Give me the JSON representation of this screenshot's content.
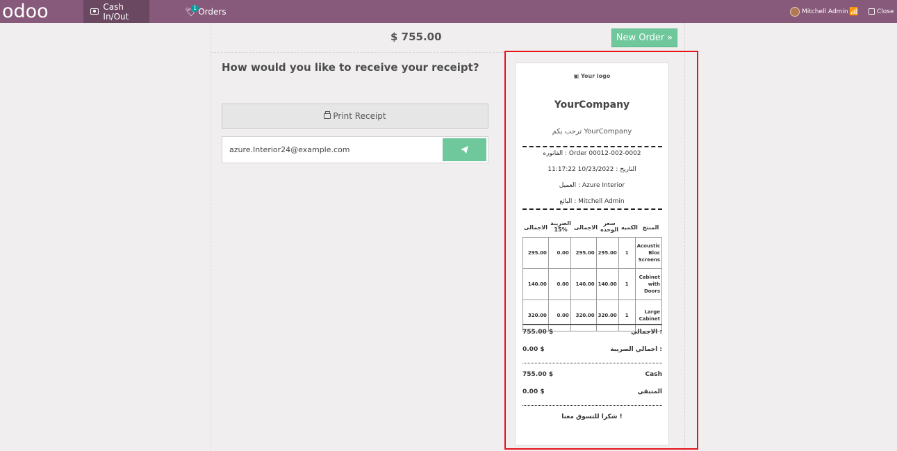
{
  "navbar": {
    "logo_text": "odoo",
    "cash_label": "Cash In/Out",
    "orders_label": "Orders",
    "orders_badge": "1",
    "user_name": "Mitchell Admin",
    "close_label": "Close"
  },
  "main": {
    "amount": "$ 755.00",
    "new_order_label": "New Order »",
    "question": "How would you like to receive your receipt?",
    "print_label": "Print Receipt",
    "email_value": "azure.Interior24@example.com"
  },
  "receipt": {
    "logo": "Your logo",
    "company": "YourCompany",
    "welcome": "ترحب بكم YourCompany",
    "order_line": "الفاتوره : Order 00012-002-0002",
    "date_line": "التاريخ : 10/23/2022 11:17:22",
    "customer_line": "العميل : Azure Interior",
    "seller_line": "البائع : Mitchell Admin",
    "headers": {
      "product": "المنتج",
      "qty": "الكميه",
      "unit_price": "سعر الوحده",
      "total": "الاجمالى",
      "tax": "الضريبة 15%",
      "grand": "الاجمالى"
    },
    "lines": [
      {
        "product": "Acoustic Bloc Screens",
        "qty": "1",
        "unit_price": "295.00",
        "total": "295.00",
        "tax": "0.00",
        "grand": "295.00"
      },
      {
        "product": "Cabinet with Doors",
        "qty": "1",
        "unit_price": "140.00",
        "total": "140.00",
        "tax": "0.00",
        "grand": "140.00"
      },
      {
        "product": "Large Cabinet",
        "qty": "1",
        "unit_price": "320.00",
        "total": "320.00",
        "tax": "0.00",
        "grand": "320.00"
      }
    ],
    "total_label": "الاجمالي :",
    "total_value": "755.00 $",
    "tax_label": "اجمالي الضريبة :",
    "tax_value": "0.00 $",
    "cash_label": "Cash",
    "cash_value": "755.00 $",
    "change_label": "المتبقي",
    "change_value": "0.00 $",
    "thanks": "شكرا للتسوق معنا !"
  },
  "colors": {
    "navbar": "#875a7b",
    "accent_green": "#6ec89b",
    "highlight_red": "#e3141a"
  }
}
